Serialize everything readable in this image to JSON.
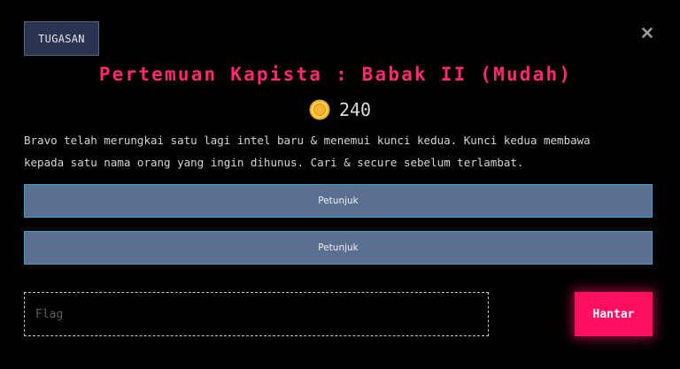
{
  "challenge": {
    "category_label": "TUGASAN",
    "title": "Pertemuan Kapista : Babak II (Mudah)",
    "points": "240",
    "description_lines": [
      "Bravo telah merungkai satu lagi intel baru & menemui kunci kedua. Kunci kedua membawa",
      "kepada satu nama orang yang ingin dihunus. Cari & secure sebelum terlambat."
    ]
  },
  "hints": [
    {
      "label": "Petunjuk"
    },
    {
      "label": "Petunjuk"
    }
  ],
  "form": {
    "flag_placeholder": "Flag",
    "flag_value": "",
    "submit_label": "Hantar"
  },
  "icons": {
    "close": "close-icon",
    "coin": "coin-icon"
  },
  "colors": {
    "title": "#ff2a6d",
    "submit": "#ff0f5f",
    "hint_bg": "#5a7090",
    "tag_bg": "#2a3350"
  }
}
